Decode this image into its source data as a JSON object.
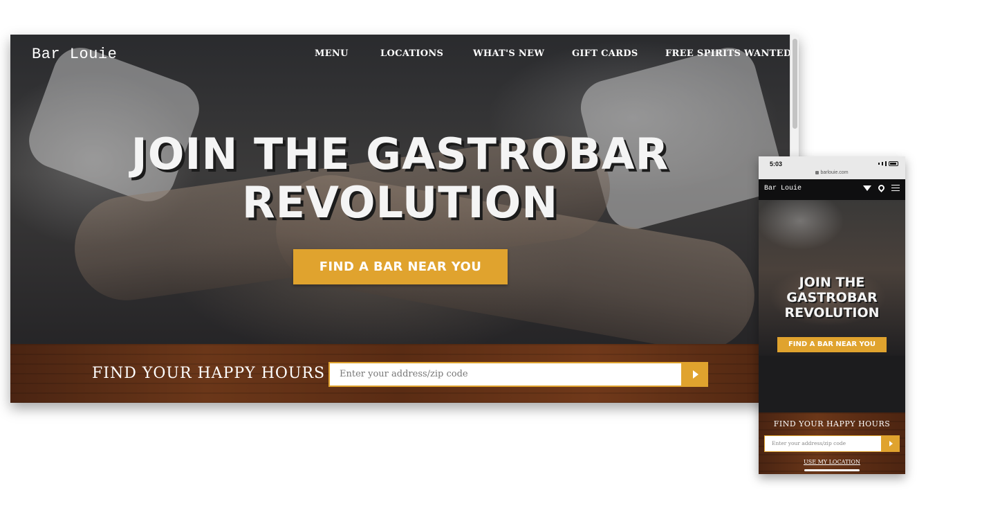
{
  "desktop": {
    "logo": "Bar Louie",
    "nav": [
      "MENU",
      "LOCATIONS",
      "WHAT'S NEW",
      "GIFT CARDS",
      "FREE SPIRITS WANTED"
    ],
    "headline_line1": "JOIN THE GASTROBAR",
    "headline_line2": "REVOLUTION",
    "cta_label": "FIND A BAR NEAR YOU",
    "happy_hours_title": "FIND YOUR HAPPY HOURS",
    "search_placeholder": "Enter your address/zip code"
  },
  "phone": {
    "status_time": "5:03",
    "url": "barlouie.com",
    "logo": "Bar Louie",
    "headline_line1": "JOIN THE",
    "headline_line2": "GASTROBAR",
    "headline_line3": "REVOLUTION",
    "cta_label": "FIND A BAR NEAR YOU",
    "happy_hours_title": "FIND YOUR HAPPY HOURS",
    "search_placeholder": "Enter your address/zip code",
    "use_location": "USE MY LOCATION"
  },
  "icons": [
    "search-arrow-icon",
    "cocktail-icon",
    "location-pin-icon",
    "hamburger-menu-icon",
    "lock-icon",
    "battery-icon",
    "signal-icon"
  ],
  "colors": {
    "accent": "#e0a32e",
    "wood": "#5a2c14",
    "header": "#0f0f10"
  }
}
